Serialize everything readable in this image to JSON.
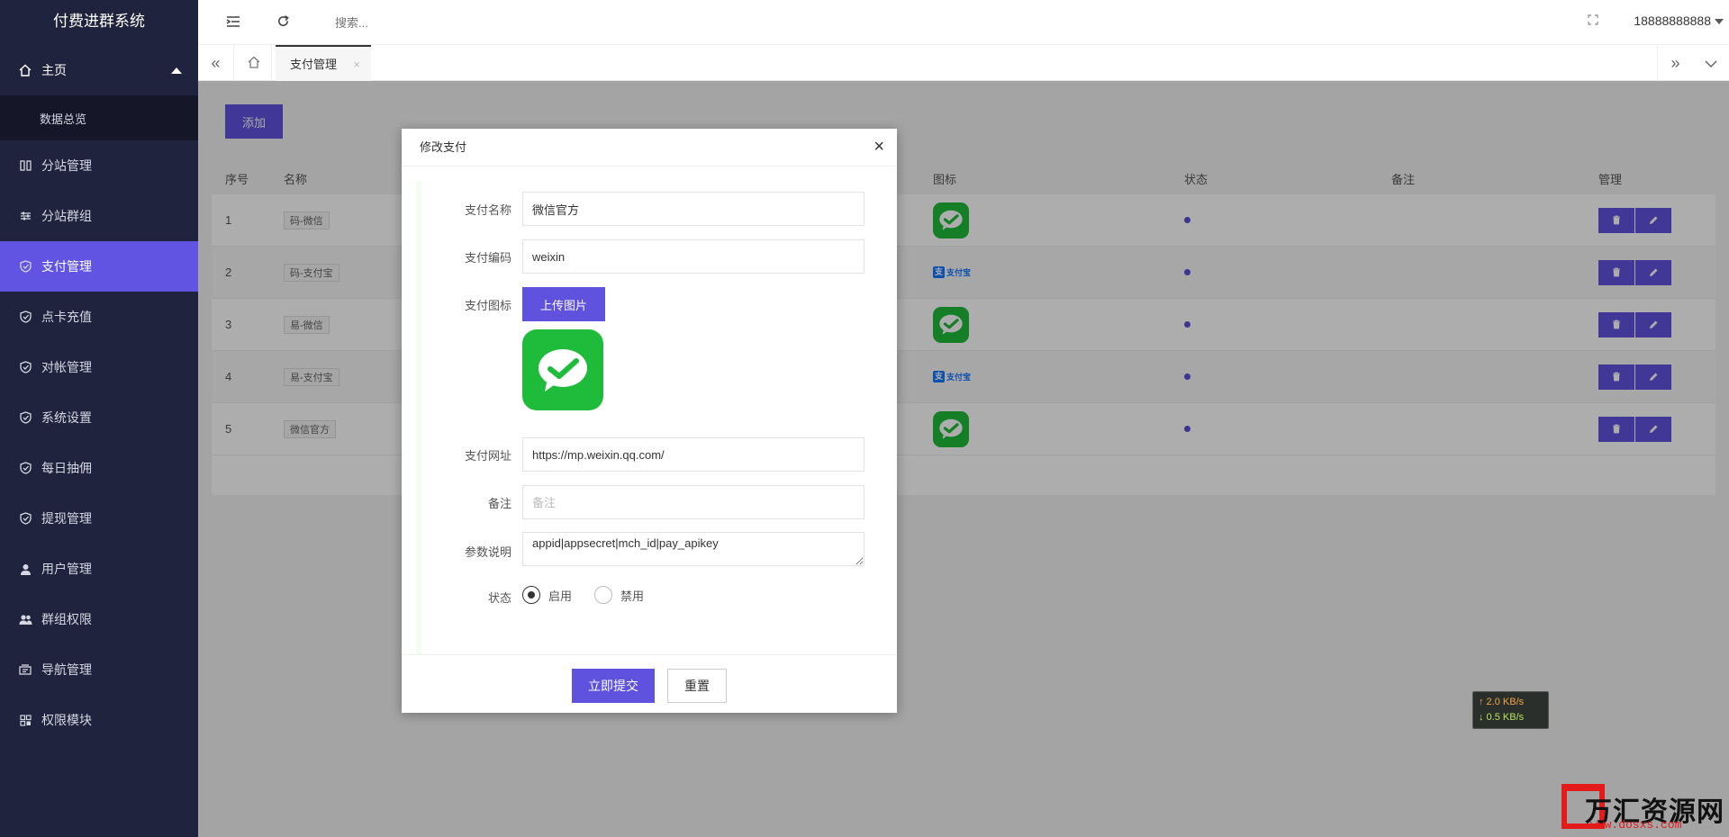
{
  "app": {
    "title": "付费进群系统"
  },
  "sidebar": {
    "home": {
      "label": "主页",
      "sub": "数据总览"
    },
    "items": [
      {
        "label": "分站管理",
        "icon": "columns-icon"
      },
      {
        "label": "分站群组",
        "icon": "sliders-icon"
      },
      {
        "label": "支付管理",
        "icon": "shield-check-icon",
        "active": true
      },
      {
        "label": "点卡充值",
        "icon": "shield-check-icon"
      },
      {
        "label": "对帐管理",
        "icon": "shield-check-icon"
      },
      {
        "label": "系统设置",
        "icon": "shield-check-icon"
      },
      {
        "label": "每日抽佣",
        "icon": "shield-check-icon"
      },
      {
        "label": "提现管理",
        "icon": "shield-check-icon"
      },
      {
        "label": "用户管理",
        "icon": "user-icon"
      },
      {
        "label": "群组权限",
        "icon": "users-icon"
      },
      {
        "label": "导航管理",
        "icon": "nav-icon"
      },
      {
        "label": "权限模块",
        "icon": "grid-icon"
      }
    ]
  },
  "header": {
    "search_placeholder": "搜索...",
    "user": "18888888888"
  },
  "tabs": {
    "active": "支付管理",
    "close": "×"
  },
  "main": {
    "add_label": "添加",
    "columns": {
      "no": "序号",
      "name": "名称",
      "icon": "图标",
      "status": "状态",
      "note": "备注",
      "manage": "管理"
    },
    "rows": [
      {
        "no": "1",
        "name": "码-微信",
        "icon": "wechat"
      },
      {
        "no": "2",
        "name": "码-支付宝",
        "icon": "alipay"
      },
      {
        "no": "3",
        "name": "易-微信",
        "icon": "wechat"
      },
      {
        "no": "4",
        "name": "易-支付宝",
        "icon": "alipay"
      },
      {
        "no": "5",
        "name": "微信官方",
        "icon": "wechat"
      }
    ],
    "alipay_text": "支付宝"
  },
  "modal": {
    "title": "修改支付",
    "close": "×",
    "fields": {
      "name": {
        "label": "支付名称",
        "value": "微信官方"
      },
      "code": {
        "label": "支付编码",
        "value": "weixin"
      },
      "icon": {
        "label": "支付图标",
        "upload": "上传图片"
      },
      "url": {
        "label": "支付网址",
        "value": "https://mp.weixin.qq.com/"
      },
      "note": {
        "label": "备注",
        "placeholder": "备注",
        "value": ""
      },
      "params": {
        "label": "参数说明",
        "value": "appid|appsecret|mch_id|pay_apikey"
      },
      "status": {
        "label": "状态",
        "on": "启用",
        "off": "禁用",
        "selected": "on"
      }
    },
    "submit": "立即提交",
    "reset": "重置"
  },
  "speed": {
    "up": "↑ 2.0 KB/s",
    "down": "↓ 0.5 KB/s"
  },
  "watermark": {
    "text": "万汇资源网",
    "url": "www.dosxs.com"
  },
  "colors": {
    "accent": "#5f52de",
    "sidebar": "#20233e",
    "wechat": "#1fbc3c",
    "alipay": "#1677ff"
  }
}
